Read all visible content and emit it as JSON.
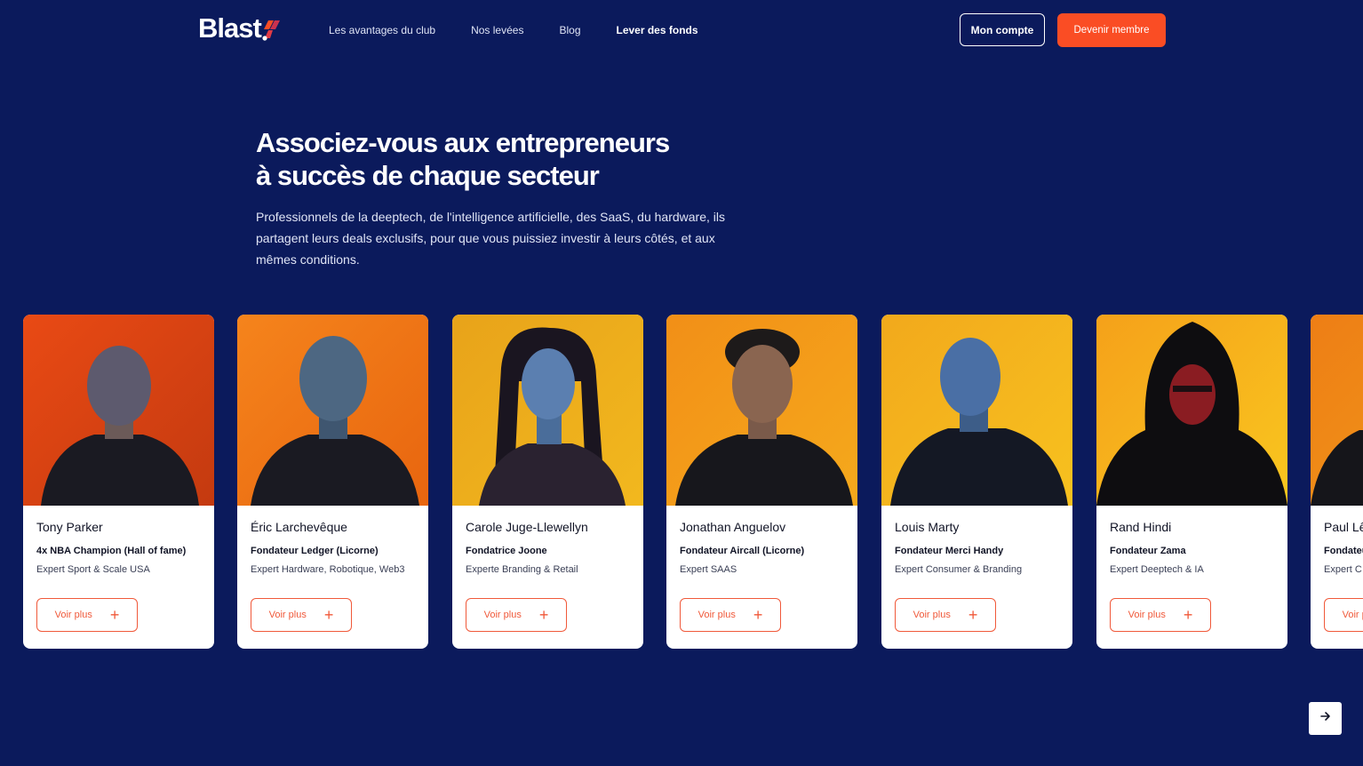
{
  "brand": {
    "name": "Blast",
    "accent": "#fa4d24",
    "background": "#0b1a5c"
  },
  "nav": {
    "links": [
      "Les avantages du club",
      "Nos levées",
      "Blog",
      "Lever des fonds"
    ]
  },
  "header": {
    "account_label": "Mon compte",
    "member_label": "Devenir membre"
  },
  "hero": {
    "title_line1": "Associez-vous aux entrepreneurs",
    "title_line2": "à succès de chaque secteur",
    "description": "Professionnels de la deeptech, de l'intelligence artificielle, des SaaS, du hardware, ils partagent leurs deals exclusifs, pour que vous puissiez investir à leurs côtés, et aux mêmes conditions."
  },
  "members": [
    {
      "name": "Tony Parker",
      "role": "4x NBA Champion (Hall of fame)",
      "expertise": "Expert Sport & Scale USA",
      "cta": "Voir plus"
    },
    {
      "name": "Éric Larchevêque",
      "role": "Fondateur Ledger (Licorne)",
      "expertise": "Expert Hardware, Robotique, Web3",
      "cta": "Voir plus"
    },
    {
      "name": "Carole Juge-Llewellyn",
      "role": "Fondatrice Joone",
      "expertise": "Experte Branding & Retail",
      "cta": "Voir plus"
    },
    {
      "name": "Jonathan Anguelov",
      "role": "Fondateur Aircall (Licorne)",
      "expertise": "Expert SAAS",
      "cta": "Voir plus"
    },
    {
      "name": "Louis Marty",
      "role": "Fondateur Merci Handy",
      "expertise": "Expert Consumer & Branding",
      "cta": "Voir plus"
    },
    {
      "name": "Rand Hindi",
      "role": "Fondateur Zama",
      "expertise": "Expert Deeptech & IA",
      "cta": "Voir plus"
    },
    {
      "name": "Paul Lê",
      "role": "Fondateur",
      "expertise": "Expert C",
      "cta": "Voir plus"
    }
  ],
  "carousel": {
    "next_icon": "arrow-right-icon"
  }
}
